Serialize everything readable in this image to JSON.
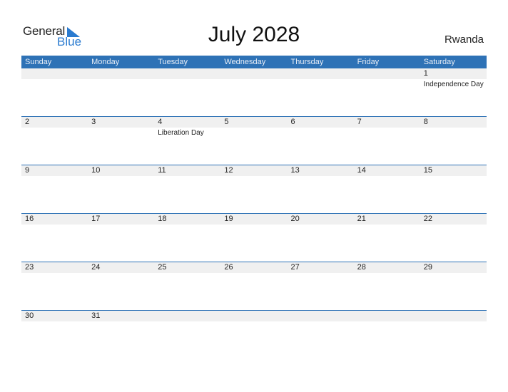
{
  "brand": {
    "word1": "General",
    "word2": "Blue",
    "accent": "#2a7bd0"
  },
  "title": "July 2028",
  "country": "Rwanda",
  "colors": {
    "header_bg": "#2e72b6",
    "strip_bg": "#f0f0f0"
  },
  "weekdays": [
    "Sunday",
    "Monday",
    "Tuesday",
    "Wednesday",
    "Thursday",
    "Friday",
    "Saturday"
  ],
  "weeks": [
    [
      {
        "day": "",
        "holiday": ""
      },
      {
        "day": "",
        "holiday": ""
      },
      {
        "day": "",
        "holiday": ""
      },
      {
        "day": "",
        "holiday": ""
      },
      {
        "day": "",
        "holiday": ""
      },
      {
        "day": "",
        "holiday": ""
      },
      {
        "day": "1",
        "holiday": "Independence Day"
      }
    ],
    [
      {
        "day": "2",
        "holiday": ""
      },
      {
        "day": "3",
        "holiday": ""
      },
      {
        "day": "4",
        "holiday": "Liberation Day"
      },
      {
        "day": "5",
        "holiday": ""
      },
      {
        "day": "6",
        "holiday": ""
      },
      {
        "day": "7",
        "holiday": ""
      },
      {
        "day": "8",
        "holiday": ""
      }
    ],
    [
      {
        "day": "9",
        "holiday": ""
      },
      {
        "day": "10",
        "holiday": ""
      },
      {
        "day": "11",
        "holiday": ""
      },
      {
        "day": "12",
        "holiday": ""
      },
      {
        "day": "13",
        "holiday": ""
      },
      {
        "day": "14",
        "holiday": ""
      },
      {
        "day": "15",
        "holiday": ""
      }
    ],
    [
      {
        "day": "16",
        "holiday": ""
      },
      {
        "day": "17",
        "holiday": ""
      },
      {
        "day": "18",
        "holiday": ""
      },
      {
        "day": "19",
        "holiday": ""
      },
      {
        "day": "20",
        "holiday": ""
      },
      {
        "day": "21",
        "holiday": ""
      },
      {
        "day": "22",
        "holiday": ""
      }
    ],
    [
      {
        "day": "23",
        "holiday": ""
      },
      {
        "day": "24",
        "holiday": ""
      },
      {
        "day": "25",
        "holiday": ""
      },
      {
        "day": "26",
        "holiday": ""
      },
      {
        "day": "27",
        "holiday": ""
      },
      {
        "day": "28",
        "holiday": ""
      },
      {
        "day": "29",
        "holiday": ""
      }
    ],
    [
      {
        "day": "30",
        "holiday": ""
      },
      {
        "day": "31",
        "holiday": ""
      },
      {
        "day": "",
        "holiday": ""
      },
      {
        "day": "",
        "holiday": ""
      },
      {
        "day": "",
        "holiday": ""
      },
      {
        "day": "",
        "holiday": ""
      },
      {
        "day": "",
        "holiday": ""
      }
    ]
  ]
}
